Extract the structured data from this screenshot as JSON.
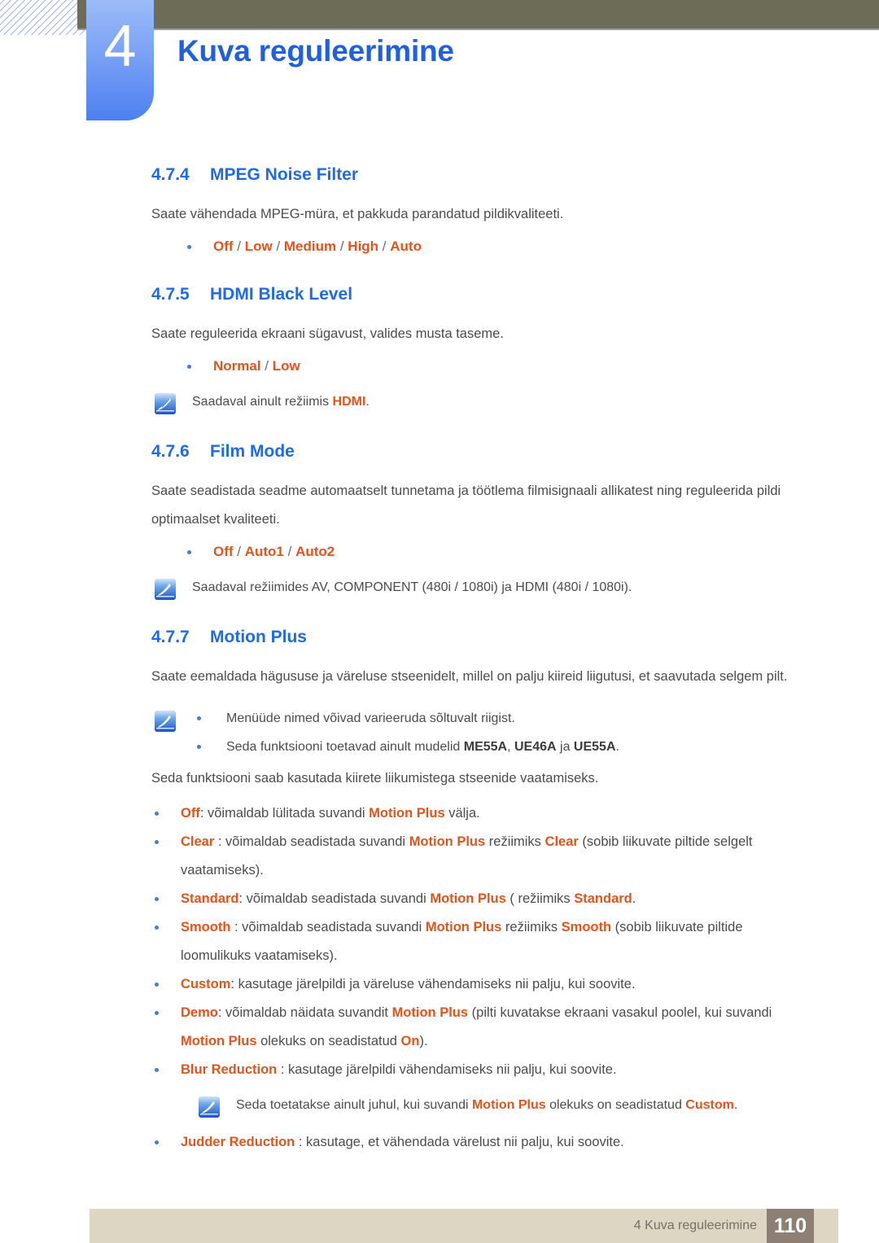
{
  "header": {
    "chapter_number": "4",
    "chapter_title": "Kuva reguleerimine"
  },
  "colors": {
    "heading_blue": "#1f6ae8",
    "title_blue": "#1f5fe0",
    "highlight_orange": "#e2541c",
    "olive_bar": "#6d6d57",
    "footer_bar": "#dcd6c3",
    "page_box": "#8e7f74",
    "bullet_blue": "#4a7bd0"
  },
  "sections": [
    {
      "num": "4.7.4",
      "title": "MPEG Noise Filter",
      "body": "Saate vähendada MPEG-müra, et pakkuda parandatud pildikvaliteeti.",
      "options": [
        "Off",
        "Low",
        "Medium",
        "High",
        "Auto"
      ]
    },
    {
      "num": "4.7.5",
      "title": "HDMI Black Level",
      "body": "Saate reguleerida ekraani sügavust, valides musta taseme.",
      "options": [
        "Normal",
        "Low"
      ],
      "note_pre": "Saadaval ainult režiimis ",
      "note_hl": "HDMI",
      "note_post": "."
    },
    {
      "num": "4.7.6",
      "title": "Film Mode",
      "body": "Saate seadistada seadme automaatselt tunnetama ja töötlema filmisignaali allikatest ning reguleerida pildi optimaalset kvaliteeti.",
      "options": [
        "Off",
        "Auto1",
        "Auto2"
      ],
      "note": "Saadaval režiimides AV, COMPONENT (480i / 1080i) ja HDMI (480i / 1080i)."
    },
    {
      "num": "4.7.7",
      "title": "Motion Plus",
      "body": "Saate eemaldada hägususe ja väreluse stseenidelt, millel on palju kiireid liigutusi, et saavutada selgem pilt.",
      "note_bullets": [
        {
          "pre": "Menüüde nimed võivad varieeruda sõltuvalt riigist.",
          "models": []
        },
        {
          "pre": "Seda funktsiooni toetavad ainult mudelid ",
          "models": [
            "ME55A",
            "UE46A",
            "UE55A"
          ],
          "joiner": ", ",
          "last_joiner": " ja ",
          "post": "."
        }
      ],
      "body2": "Seda funktsiooni saab kasutada kiirete liikumistega stseenide vaatamiseks."
    }
  ],
  "motion_plus_items": [
    {
      "term": "Off",
      "after_term": ": võimaldab lülitada suvandi ",
      "mid_hl": "Motion Plus",
      "tail": " välja."
    },
    {
      "term": "Clear",
      "after_term": " : võimaldab seadistada suvandi ",
      "mid_hl": "Motion Plus",
      "mid_text": " režiimiks ",
      "mid_hl2": "Clear",
      "tail": " (sobib liikuvate piltide selgelt vaatamiseks)."
    },
    {
      "term": "Standard",
      "after_term": ": võimaldab seadistada suvandi ",
      "mid_hl": "Motion Plus",
      "mid_text": " ( režiimiks ",
      "mid_hl2": "Standard",
      "tail": "."
    },
    {
      "term": "Smooth",
      "after_term": " : võimaldab seadistada suvandi ",
      "mid_hl": "Motion Plus",
      "mid_text": " režiimiks ",
      "mid_hl2": "Smooth",
      "tail": " (sobib liikuvate piltide loomulikuks vaatamiseks)."
    },
    {
      "term": "Custom",
      "after_term": ": kasutage järelpildi ja väreluse vähendamiseks nii palju, kui soovite.",
      "mid_hl": "",
      "tail": ""
    },
    {
      "term": "Demo",
      "after_term": ": võimaldab näidata suvandit ",
      "mid_hl": "Motion Plus",
      "mid_text": " (pilti kuvatakse ekraani vasakul poolel, kui suvandi ",
      "mid_hl2": "Motion Plus",
      "mid_text2": " olekuks on seadistatud ",
      "mid_hl3": "On",
      "tail": ")."
    },
    {
      "term": "Blur Reduction",
      "after_term": " : kasutage järelpildi vähendamiseks nii palju, kui soovite.",
      "mid_hl": "",
      "tail": ""
    }
  ],
  "blur_note": {
    "pre": "Seda toetatakse ainult juhul, kui suvandi ",
    "hl1": "Motion Plus",
    "mid": " olekuks on seadistatud ",
    "hl2": "Custom",
    "post": "."
  },
  "judder_item": {
    "term": "Judder Reduction",
    "after_term": " : kasutage, et vähendada värelust nii palju, kui soovite."
  },
  "footer": {
    "text": "4 Kuva reguleerimine",
    "page": "110"
  },
  "icons": {
    "note": "note-pen-icon"
  }
}
